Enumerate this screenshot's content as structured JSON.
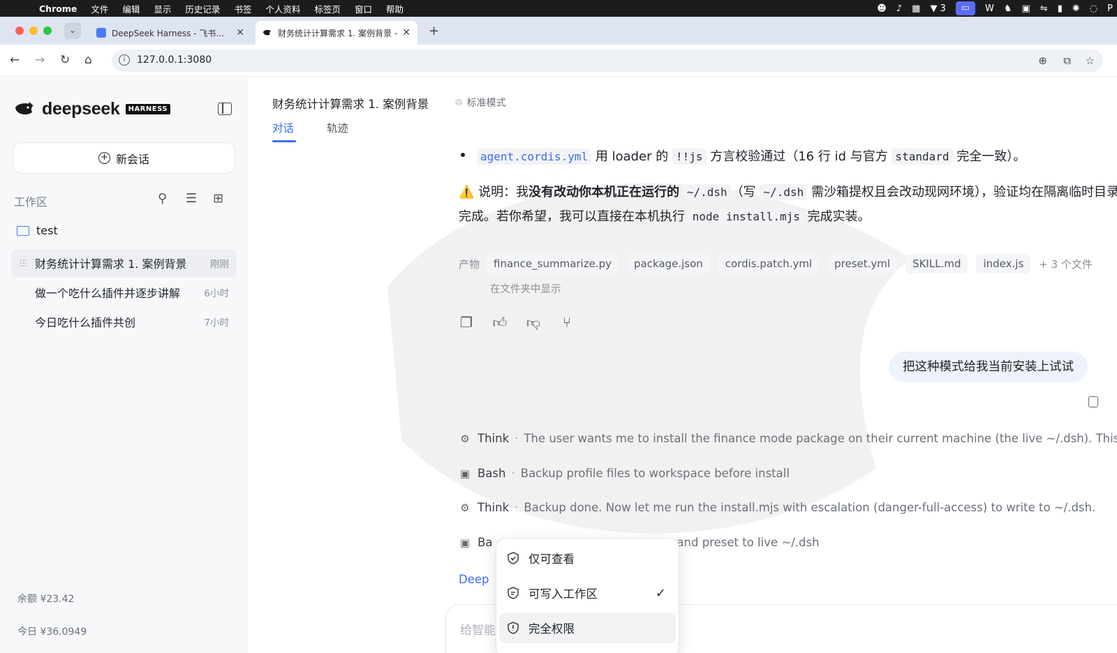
{
  "menubar": {
    "app": "Chrome",
    "items": [
      "文件",
      "编辑",
      "显示",
      "历史记录",
      "书签",
      "个人资料",
      "标签页",
      "窗口",
      "帮助"
    ],
    "status_badge": "3"
  },
  "tabs": [
    {
      "title": "DeepSeek Harness - 飞书云文"
    },
    {
      "title": "财务统计计算需求 1. 案例背景 -"
    }
  ],
  "address": {
    "url": "127.0.0.1:3080"
  },
  "sidebar": {
    "logo_text": "deepseek",
    "logo_badge": "HARNESS",
    "new_chat": "新会话",
    "workspace_label": "工作区",
    "folder": "test",
    "conversations": [
      {
        "title": "财务统计计算需求 1. 案例背景",
        "time": "刚刚"
      },
      {
        "title": "做一个吃什么插件并逐步讲解",
        "time": "6小时"
      },
      {
        "title": "今日吃什么插件共创",
        "time": "7小时"
      }
    ],
    "balance": "余额 ¥23.42",
    "today": "今日 ¥36.0949"
  },
  "header": {
    "title": "财务统计计算需求 1. 案例背景",
    "mode": "标准模式",
    "tabs": [
      "对话",
      "轨迹"
    ]
  },
  "message": {
    "bullet": {
      "code1": "agent.cordis.yml",
      "t1": " 用 loader 的 ",
      "code2": "!!js",
      "t2": " 方言校验通过（16 行 id 与官方 ",
      "code3": "standard",
      "t3": " 完全一致）。"
    },
    "note": {
      "icon": "⚠️",
      "t1": " 说明：我",
      "bold": "没有改动你本机正在运行的",
      "code1": "~/.dsh",
      "t2": "（写 ",
      "code2": "~/.dsh",
      "t3": " 需沙箱提权且会改动现网环境），验证均在隔离临时目录完成。若你希望，我可以直接在本机执行 ",
      "code3": "node install.mjs",
      "t4": " 完成实装。"
    },
    "artifacts_label": "产物",
    "artifacts": [
      "finance_summarize.py",
      "package.json",
      "cordis.patch.yml",
      "preset.yml",
      "SKILL.md",
      "index.js"
    ],
    "more_files": "+ 3 个文件",
    "show_in_folder": "在文件夹中显示"
  },
  "user_message": "把这种模式给我当前安装上试试",
  "steps": [
    {
      "kind": "Think",
      "desc": "The user wants me to install the finance mode package on their current machine (the live ~/.dsh). This"
    },
    {
      "kind": "Bash",
      "desc": "Backup profile files to workspace before install"
    },
    {
      "kind": "Think",
      "desc": "Backup done. Now let me run the install.mjs with escalation (danger-full-access) to write to ~/.dsh."
    },
    {
      "kind": "Ba",
      "desc": "and preset to live ~/.dsh"
    }
  ],
  "deep_link": "Deep",
  "input": {
    "placeholder": "给智能"
  },
  "permission_menu": {
    "items": [
      {
        "label": "仅可查看",
        "checked": false
      },
      {
        "label": "可写入工作区",
        "checked": true
      },
      {
        "label": "完全权限",
        "checked": false
      }
    ]
  },
  "colors": {
    "accent": "#3b6cf6",
    "sidebar_bg": "#f7f8fa",
    "bubble_bg": "#eef3fb"
  }
}
